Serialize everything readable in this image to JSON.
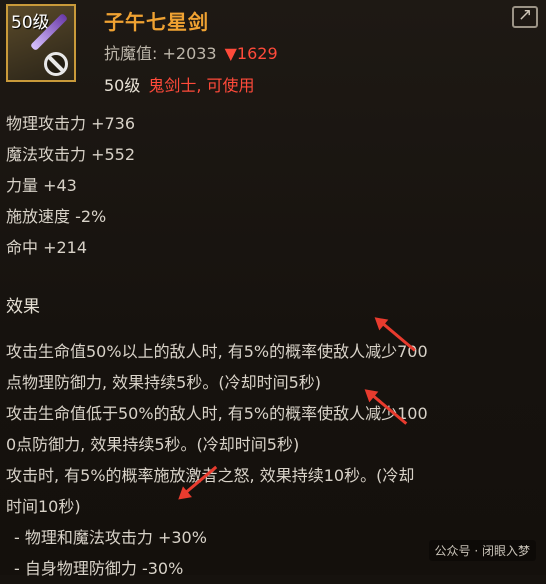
{
  "item": {
    "level_tag": "50级",
    "name": "子午七星剑",
    "resist_label": "抗魔值: +2033",
    "resist_down": "▼1629",
    "req_level": "50级",
    "req_class": "鬼剑士, 可使用"
  },
  "stats": [
    "物理攻击力 +736",
    "魔法攻击力 +552",
    "力量 +43",
    "施放速度 -2%",
    "命中 +214"
  ],
  "effects_title": "效果",
  "effects": [
    "攻击生命值50%以上的敌人时, 有5%的概率使敌人减少700",
    "点物理防御力, 效果持续5秒。(冷却时间5秒)",
    "攻击生命值低于50%的敌人时, 有5%的概率使敌人减少100",
    "0点防御力, 效果持续5秒。(冷却时间5秒)",
    "攻击时, 有5%的概率施放激者之怒, 效果持续10秒。(冷却",
    "时间10秒)",
    "- 物理和魔法攻击力 +30%",
    "- 自身物理防御力 -30%"
  ],
  "watermark": "公众号 · 闭眼入梦",
  "colors": {
    "name": "#f0a232",
    "warning": "#ff4a3a",
    "annotation_arrow": "#e83b2e"
  }
}
